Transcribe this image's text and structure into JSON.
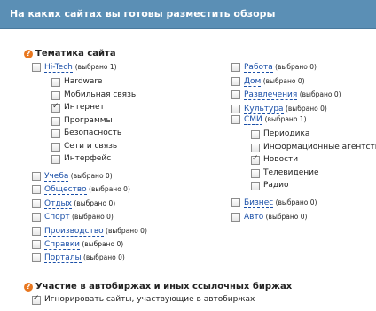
{
  "header": {
    "title": "На каких сайтах вы готовы разместить обзоры"
  },
  "topics": {
    "title": "Тематика сайта",
    "question_mark": "?",
    "hitech": {
      "label": "Hi-Tech",
      "count": "(выбрано 1)",
      "sub": [
        {
          "label": "Hardware",
          "checked": false
        },
        {
          "label": "Мобильная связь",
          "checked": false
        },
        {
          "label": "Интернет",
          "checked": true
        },
        {
          "label": "Программы",
          "checked": false
        },
        {
          "label": "Безопасность",
          "checked": false
        },
        {
          "label": "Сети и связь",
          "checked": false
        },
        {
          "label": "Интерфейс",
          "checked": false
        }
      ]
    },
    "left_categories": [
      {
        "label": "Учеба",
        "count": "(выбрано 0)"
      },
      {
        "label": "Общество",
        "count": "(выбрано 0)"
      },
      {
        "label": "Отдых",
        "count": "(выбрано 0)"
      },
      {
        "label": "Спорт",
        "count": "(выбрано 0)"
      },
      {
        "label": "Производство",
        "count": "(выбрано 0)"
      },
      {
        "label": "Справки",
        "count": "(выбрано 0)"
      },
      {
        "label": "Порталы",
        "count": "(выбрано 0)"
      }
    ],
    "right_categories_top": [
      {
        "label": "Работа",
        "count": "(выбрано 0)"
      },
      {
        "label": "Дом",
        "count": "(выбрано 0)"
      },
      {
        "label": "Развлечения",
        "count": "(выбрано 0)"
      },
      {
        "label": "Культура",
        "count": "(выбрано 0)"
      }
    ],
    "smi": {
      "label": "СМИ",
      "count": "(выбрано 1)",
      "sub": [
        {
          "label": "Периодика",
          "checked": false
        },
        {
          "label": "Информационные агентства",
          "checked": false
        },
        {
          "label": "Новости",
          "checked": true
        },
        {
          "label": "Телевидение",
          "checked": false
        },
        {
          "label": "Радио",
          "checked": false
        }
      ]
    },
    "right_categories_bottom": [
      {
        "label": "Бизнес",
        "count": "(выбрано 0)"
      },
      {
        "label": "Авто",
        "count": "(выбрано 0)"
      }
    ]
  },
  "exchanges": {
    "title": "Участие в автобиржах и иных ссылочных биржах",
    "question_mark": "?",
    "option": {
      "label": "Игнорировать сайты, участвующие в автобиржах",
      "checked": true
    }
  }
}
